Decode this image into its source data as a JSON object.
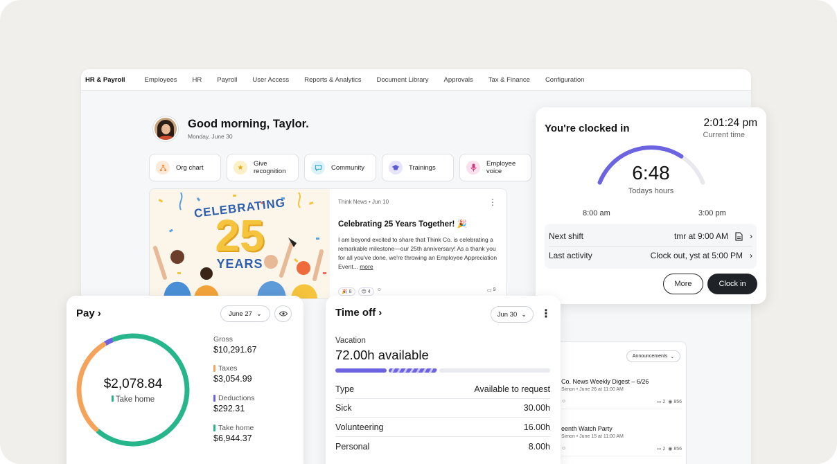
{
  "nav": {
    "brand": "HR & Payroll",
    "items": [
      "Employees",
      "HR",
      "Payroll",
      "User Access",
      "Reports & Analytics",
      "Document Library",
      "Approvals",
      "Tax & Finance",
      "Configuration"
    ]
  },
  "greeting": {
    "title": "Good morning, Taylor.",
    "date": "Monday, June 30"
  },
  "quick_actions": [
    {
      "label": "Org chart",
      "icon": "org-chart-icon",
      "color": "#f08a3c"
    },
    {
      "label": "Give recognition",
      "icon": "star-icon",
      "color": "#e0a81c"
    },
    {
      "label": "Community",
      "icon": "chat-icon",
      "color": "#2aa7c9"
    },
    {
      "label": "Trainings",
      "icon": "graduation-cap-icon",
      "color": "#5d5bd4"
    },
    {
      "label": "Employee voice",
      "icon": "microphone-icon",
      "color": "#d03a7c"
    }
  ],
  "news": {
    "banner_line1": "CELEBRATING",
    "banner_number": "25",
    "banner_line2": "YEARS",
    "meta": "Think News • Jun 10",
    "title": "Celebrating 25 Years Together! 🎉",
    "body": "I am beyond excited to share that Think Co. is celebrating a remarkable milestone—our 25th anniversary! As a thank you for all you've done, we're throwing an Employee Appreciation Event...",
    "more": "more",
    "reaction1": "🎉 8",
    "reaction2": "😊 4",
    "comments": "9"
  },
  "announcements": {
    "filter": "Announcements",
    "items": [
      {
        "title": "Co. News Weekly Digest – 6/26",
        "meta": "Simon • June 26 at 11:00 AM",
        "comments": "2",
        "views": "856"
      },
      {
        "title": "eenth Watch Party",
        "meta": "Simon • June 15 at 11:00 AM",
        "comments": "2",
        "views": "856"
      }
    ]
  },
  "clock": {
    "title": "You're clocked in",
    "current_time": "2:01:24 pm",
    "current_time_label": "Current time",
    "hours": "6:48",
    "hours_label": "Todays hours",
    "start": "8:00 am",
    "end": "3:00 pm",
    "progress": 0.74,
    "next_shift_label": "Next shift",
    "next_shift_value": "tmr at 9:00 AM",
    "last_activity_label": "Last activity",
    "last_activity_value": "Clock out, yst at 5:00 PM",
    "more_label": "More",
    "clock_in_label": "Clock in",
    "accent": "#6b63e0"
  },
  "pay": {
    "title": "Pay",
    "period": "June 27",
    "take_home_amount": "$2,078.84",
    "take_home_label": "Take home",
    "gross_label": "Gross",
    "gross_value": "$10,291.67",
    "taxes_label": "Taxes",
    "taxes_value": "$3,054.99",
    "deductions_label": "Deductions",
    "deductions_value": "$292.31",
    "takehome_label": "Take home",
    "takehome_value": "$6,944.37",
    "colors": {
      "taxes": "#f5a35a",
      "deductions": "#6b63e0",
      "take_home": "#27b58c"
    }
  },
  "timeoff": {
    "title": "Time off",
    "date": "Jun 30",
    "vacation_label": "Vacation",
    "available": "72.00h available",
    "col_type": "Type",
    "col_available": "Available to request",
    "rows": [
      {
        "type": "Sick",
        "value": "30.00h"
      },
      {
        "type": "Volunteering",
        "value": "16.00h"
      },
      {
        "type": "Personal",
        "value": "8.00h"
      }
    ]
  }
}
